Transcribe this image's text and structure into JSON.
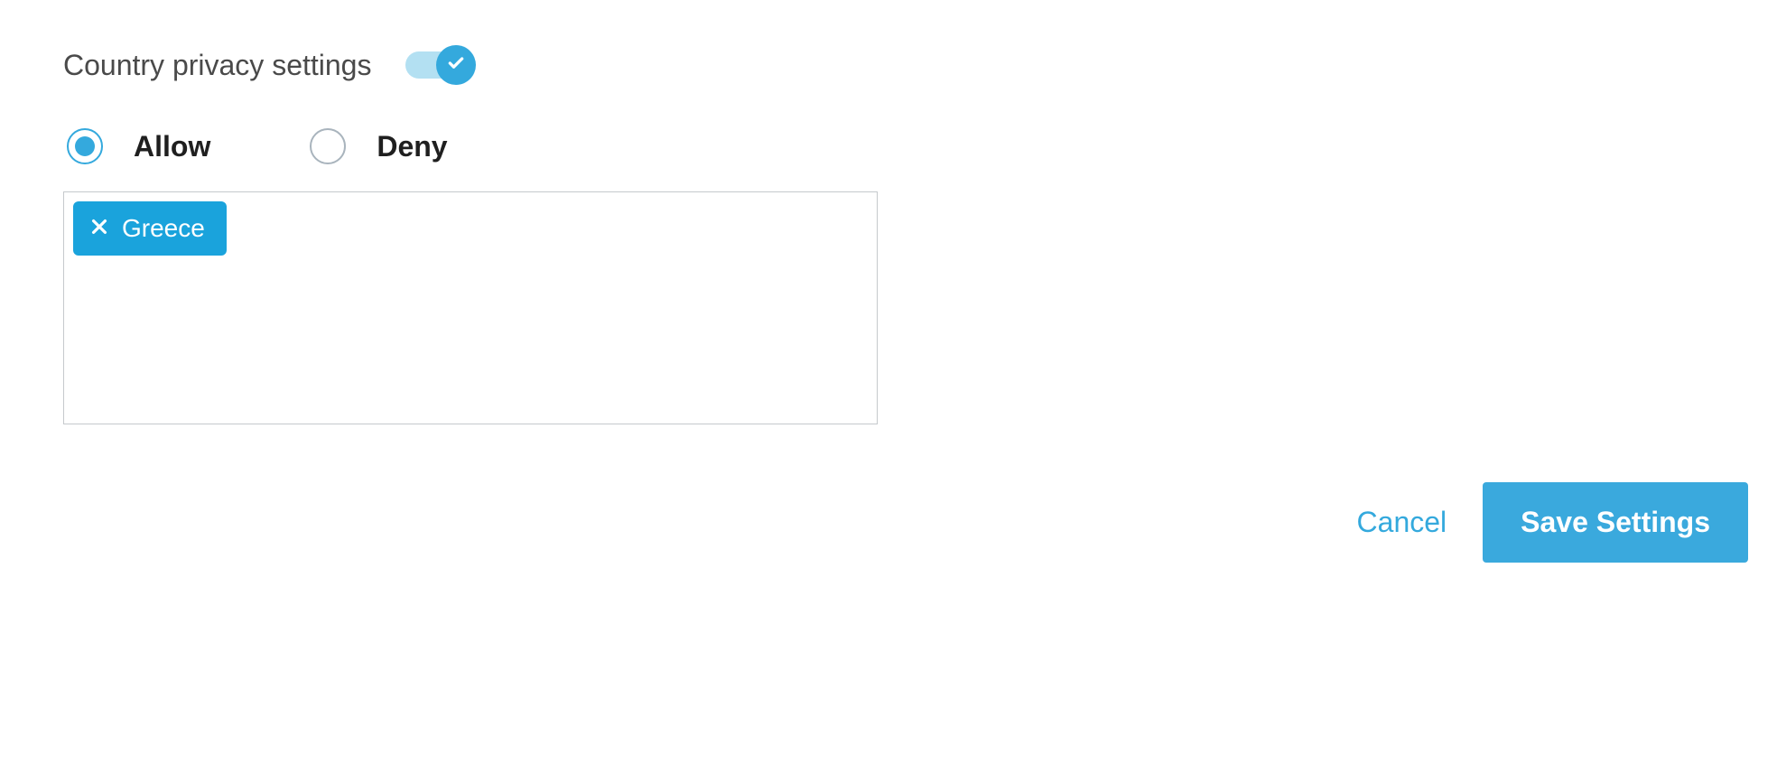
{
  "section": {
    "title": "Country privacy settings",
    "toggle_on": true
  },
  "radios": {
    "allow_label": "Allow",
    "deny_label": "Deny",
    "selected": "allow"
  },
  "tags": [
    {
      "label": "Greece"
    }
  ],
  "footer": {
    "cancel_label": "Cancel",
    "save_label": "Save Settings"
  },
  "colors": {
    "accent": "#34a9dd",
    "accent_light": "#b3e0f2",
    "tag_bg": "#1aa3dc"
  }
}
